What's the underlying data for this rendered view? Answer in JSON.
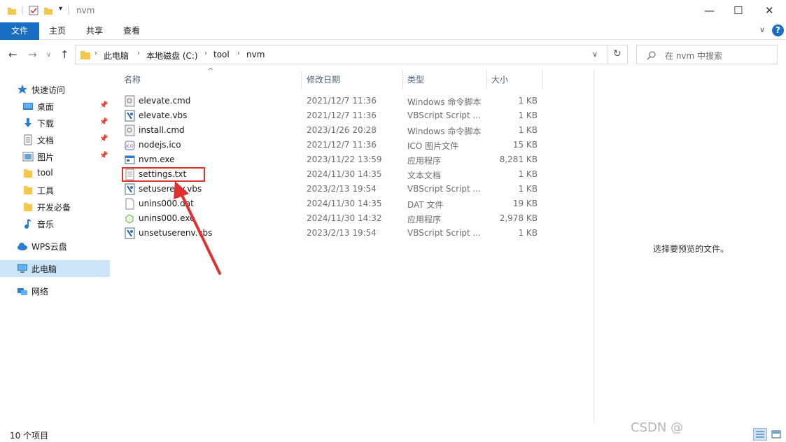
{
  "window": {
    "title": "nvm",
    "minimize": "—",
    "maximize": "☐",
    "close": "✕"
  },
  "ribbon": {
    "tabs": [
      "文件",
      "主页",
      "共享",
      "查看"
    ],
    "expand_icon": "chevron-down-icon",
    "help": "?"
  },
  "address": {
    "crumbs": [
      "此电脑",
      "本地磁盘 (C:)",
      "tool",
      "nvm"
    ],
    "search_placeholder": "在 nvm 中搜索"
  },
  "sidebar": {
    "items": [
      {
        "label": "快速访问",
        "icon": "star-icon",
        "pinned": false
      },
      {
        "label": "桌面",
        "icon": "desktop-icon",
        "pinned": true
      },
      {
        "label": "下载",
        "icon": "download-icon",
        "pinned": true
      },
      {
        "label": "文档",
        "icon": "document-icon",
        "pinned": true
      },
      {
        "label": "图片",
        "icon": "pictures-icon",
        "pinned": true
      },
      {
        "label": "tool",
        "icon": "folder-icon",
        "pinned": false
      },
      {
        "label": "工具",
        "icon": "folder-icon",
        "pinned": false
      },
      {
        "label": "开发必备",
        "icon": "folder-icon",
        "pinned": false
      },
      {
        "label": "音乐",
        "icon": "music-icon",
        "pinned": false
      },
      {
        "label": "WPS云盘",
        "icon": "cloud-icon",
        "pinned": false
      },
      {
        "label": "此电脑",
        "icon": "computer-icon",
        "pinned": false
      },
      {
        "label": "网络",
        "icon": "network-icon",
        "pinned": false
      }
    ]
  },
  "columns": [
    "名称",
    "修改日期",
    "类型",
    "大小"
  ],
  "files": [
    {
      "name": "elevate.cmd",
      "date": "2021/12/7 11:36",
      "type": "Windows 命令脚本",
      "size": "1 KB",
      "icon": "cmd-file-icon"
    },
    {
      "name": "elevate.vbs",
      "date": "2021/12/7 11:36",
      "type": "VBScript Script ...",
      "size": "1 KB",
      "icon": "vbs-file-icon"
    },
    {
      "name": "install.cmd",
      "date": "2023/1/26 20:28",
      "type": "Windows 命令脚本",
      "size": "1 KB",
      "icon": "cmd-file-icon"
    },
    {
      "name": "nodejs.ico",
      "date": "2021/12/7 11:36",
      "type": "ICO 图片文件",
      "size": "15 KB",
      "icon": "ico-file-icon"
    },
    {
      "name": "nvm.exe",
      "date": "2023/11/22 13:59",
      "type": "应用程序",
      "size": "8,281 KB",
      "icon": "exe-file-icon"
    },
    {
      "name": "settings.txt",
      "date": "2024/11/30 14:35",
      "type": "文本文档",
      "size": "1 KB",
      "icon": "txt-file-icon"
    },
    {
      "name": "setuserenv.vbs",
      "date": "2023/2/13 19:54",
      "type": "VBScript Script ...",
      "size": "1 KB",
      "icon": "vbs-file-icon"
    },
    {
      "name": "unins000.dat",
      "date": "2024/11/30 14:35",
      "type": "DAT 文件",
      "size": "19 KB",
      "icon": "dat-file-icon"
    },
    {
      "name": "unins000.exe",
      "date": "2024/11/30 14:32",
      "type": "应用程序",
      "size": "2,978 KB",
      "icon": "installer-file-icon"
    },
    {
      "name": "unsetuserenv.vbs",
      "date": "2023/2/13 19:54",
      "type": "VBScript Script ...",
      "size": "1 KB",
      "icon": "vbs-file-icon"
    }
  ],
  "preview_text": "选择要预览的文件。",
  "status": {
    "count": "10 个项目"
  },
  "watermark": "CSDN @",
  "colors": {
    "accent": "#1a6fc4",
    "highlight_box": "#e03030",
    "selected_nav": "#cce4f7"
  }
}
